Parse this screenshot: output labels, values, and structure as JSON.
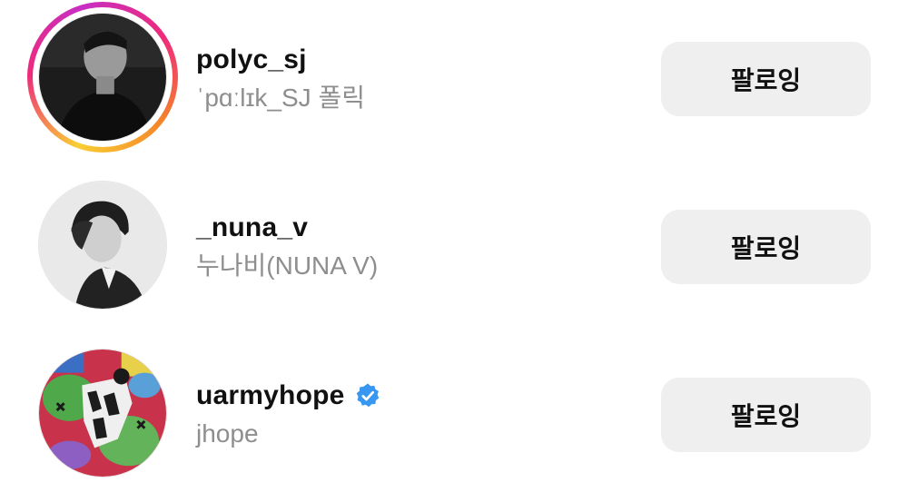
{
  "accounts": [
    {
      "username": "polyc_sj",
      "full_name": "ˈpɑːlɪk_SJ 폴릭",
      "verified": false,
      "has_story": true,
      "avatar_icon": "person-photo-grayscale",
      "button_label": "팔로잉"
    },
    {
      "username": "_nuna_v",
      "full_name": "누나비(NUNA V)",
      "verified": false,
      "has_story": false,
      "avatar_icon": "person-photo-grayscale",
      "button_label": "팔로잉"
    },
    {
      "username": "uarmyhope",
      "full_name": "jhope",
      "verified": true,
      "has_story": false,
      "avatar_icon": "colorful-art-photo",
      "button_label": "팔로잉"
    }
  ],
  "colors": {
    "primary_text": "#111111",
    "secondary_text": "#8e8e8e",
    "button_bg": "#efefef",
    "verified_badge": "#3897f0"
  }
}
